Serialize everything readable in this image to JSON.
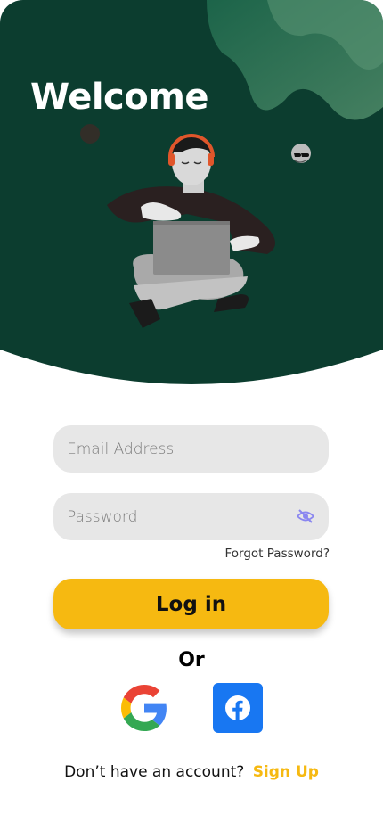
{
  "hero": {
    "title": "Welcome"
  },
  "form": {
    "email_placeholder": "Email Address",
    "password_placeholder": "Password",
    "forgot_label": "Forgot Password?",
    "login_label": "Log in"
  },
  "divider": {
    "or_label": "Or"
  },
  "social": {
    "google_icon": "google-icon",
    "facebook_icon": "facebook-icon"
  },
  "footer": {
    "prompt": "Don’t have an account?",
    "signup_label": "Sign Up"
  },
  "colors": {
    "hero_green": "#0c3d2f",
    "accent_yellow": "#f6b911",
    "field_bg": "#e7e7e7",
    "facebook_blue": "#1877f2",
    "eye_icon": "#8a86f0"
  }
}
